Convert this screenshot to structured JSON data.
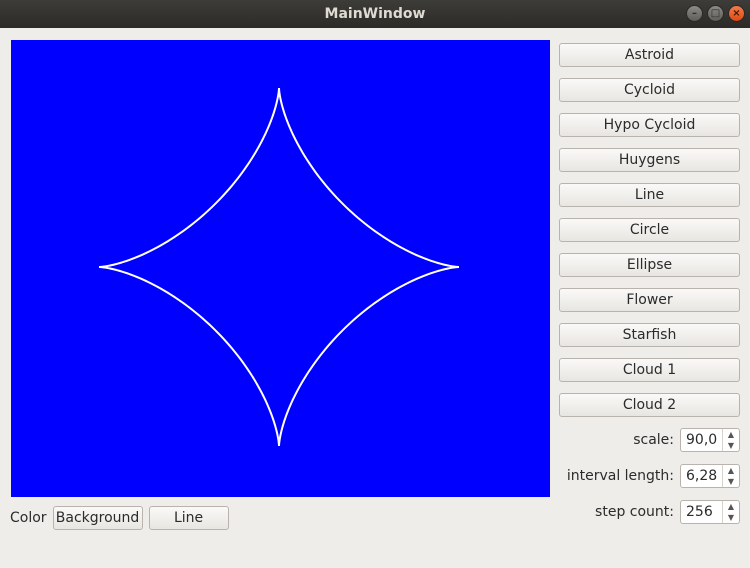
{
  "window": {
    "title": "MainWindow"
  },
  "canvas": {
    "background_color": "#0000ff",
    "curve_color": "#ffffff",
    "curve": "astroid"
  },
  "curve_buttons": [
    {
      "label": "Astroid"
    },
    {
      "label": "Cycloid"
    },
    {
      "label": "Hypo Cycloid"
    },
    {
      "label": "Huygens"
    },
    {
      "label": "Line"
    },
    {
      "label": "Circle"
    },
    {
      "label": "Ellipse"
    },
    {
      "label": "Flower"
    },
    {
      "label": "Starfish"
    },
    {
      "label": "Cloud 1"
    },
    {
      "label": "Cloud 2"
    }
  ],
  "params": {
    "scale": {
      "label": "scale:",
      "value": "90,0"
    },
    "interval": {
      "label": "interval length:",
      "value": "6,28"
    },
    "steps": {
      "label": "step count:",
      "value": "256"
    }
  },
  "color_row": {
    "label": "Color",
    "background_label": "Background",
    "line_label": "Line"
  }
}
